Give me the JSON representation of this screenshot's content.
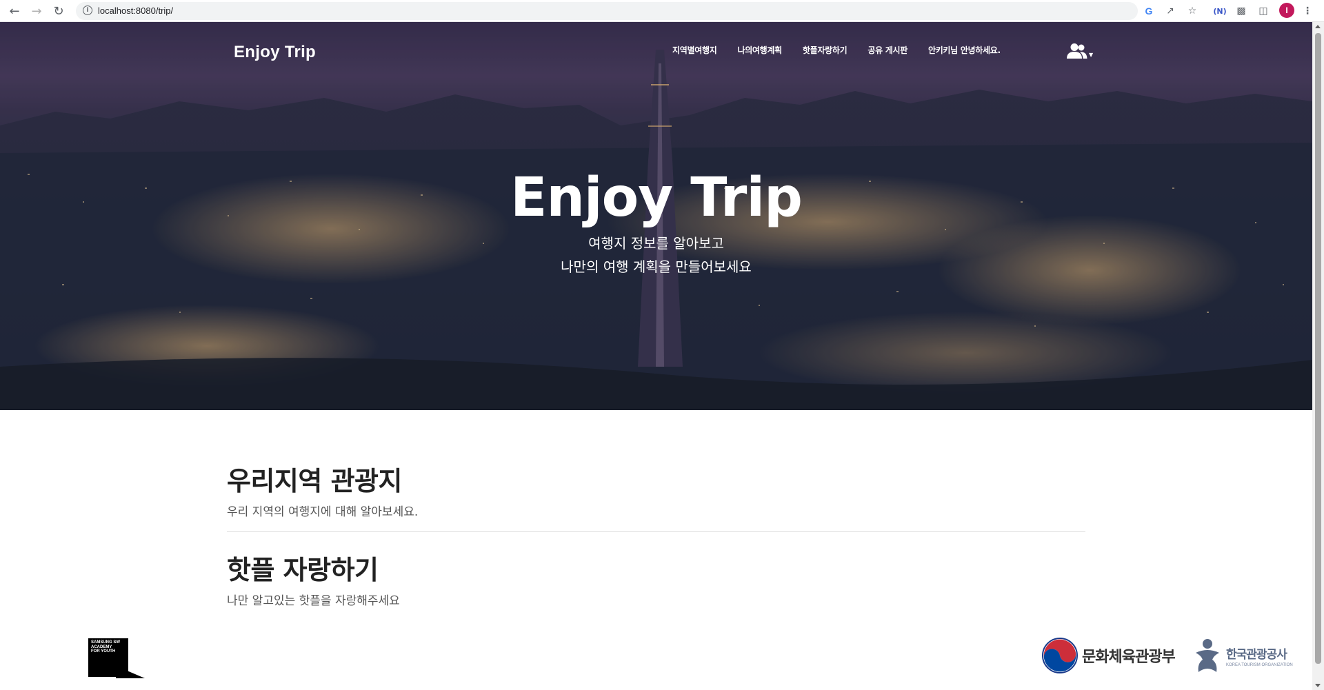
{
  "browser": {
    "url": "localhost:8080/trip/",
    "back_icon": "back-arrow-icon",
    "forward_icon": "forward-arrow-icon",
    "reload_icon": "reload-icon",
    "profile_initial": "I"
  },
  "navbar": {
    "brand": "Enjoy Trip",
    "links": [
      "지역별여행지",
      "나의여행계획",
      "핫플자랑하기",
      "공유 게시판",
      "안키키님 안녕하세요."
    ],
    "user_icon": "users-icon"
  },
  "hero": {
    "title": "Enjoy Trip",
    "subtitle_line1": "여행지 정보를 알아보고",
    "subtitle_line2": "나만의 여행 계획을 만들어보세요"
  },
  "sections": [
    {
      "title": "우리지역 관광지",
      "description": "우리 지역의 여행지에 대해 알아보세요."
    },
    {
      "title": "핫플 자랑하기",
      "description": "나만 알고있는 핫플을 자랑해주세요"
    }
  ],
  "footer": {
    "ssafy_text": "SAMSUNG SW ACADEMY FOR YOUTH",
    "mcst_name": "문화체육관광부",
    "kto_name": "한국관광공사",
    "kto_en": "KOREA TOURISM ORGANIZATION"
  }
}
